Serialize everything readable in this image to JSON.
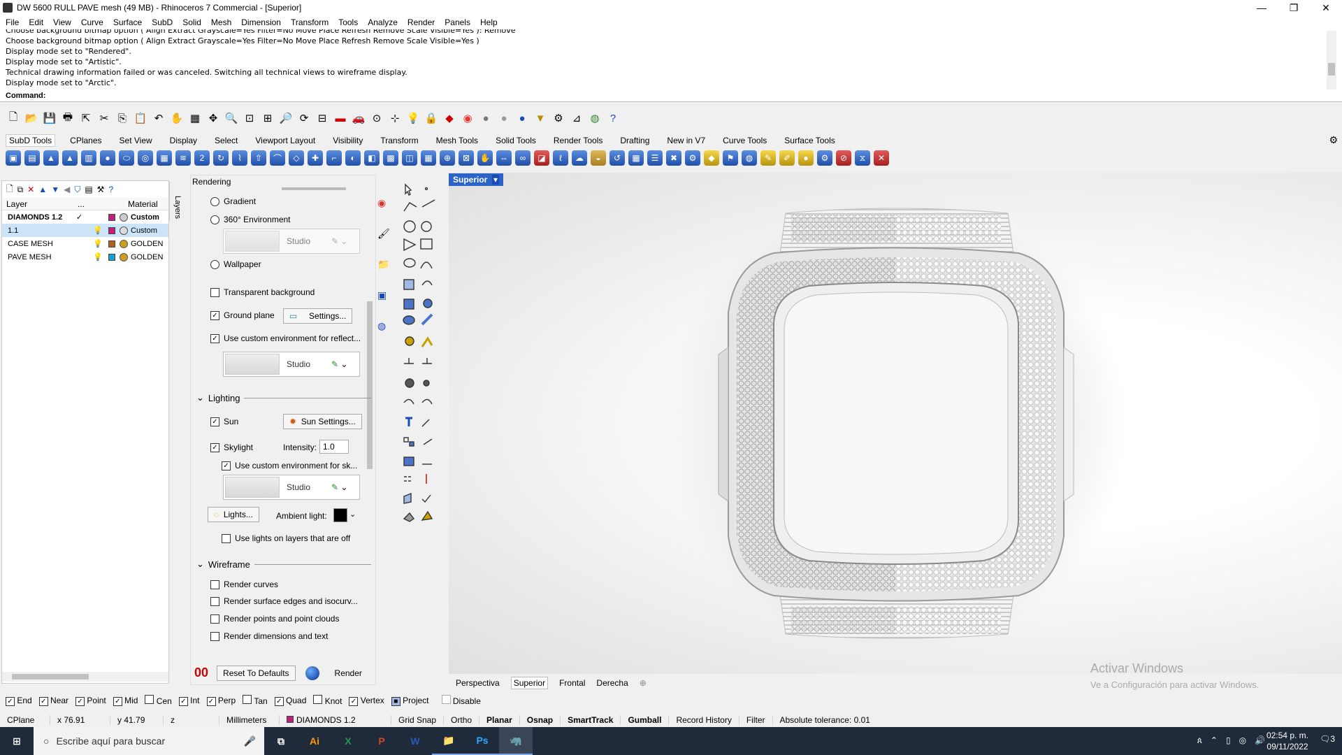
{
  "window": {
    "title": "DW 5600 RULL PAVE mesh (49 MB) - Rhinoceros 7 Commercial - [Superior]",
    "min": "—",
    "max": "❐",
    "close": "✕"
  },
  "menu": [
    "File",
    "Edit",
    "View",
    "Curve",
    "Surface",
    "SubD",
    "Solid",
    "Mesh",
    "Dimension",
    "Transform",
    "Tools",
    "Analyze",
    "Render",
    "Panels",
    "Help"
  ],
  "history": [
    "Choose background bitmap option ( Align  Extract  Grayscale=Yes  Filter=No  Move  Place  Refresh  Remove  Scale  Visible=Yes ): Remove",
    "Choose background bitmap option ( Align  Extract  Grayscale=Yes  Filter=No  Move  Place  Refresh  Remove  Scale  Visible=Yes )",
    "Display mode set to \"Rendered\".",
    "Display mode set to \"Artistic\".",
    "Technical drawing information failed or was canceled. Switching all technical views to wireframe display.",
    "Display mode set to \"Arctic\"."
  ],
  "command": {
    "label": "Command:"
  },
  "toolbar_tabs": [
    "SubD Tools",
    "CPlanes",
    "Set View",
    "Display",
    "Select",
    "Viewport Layout",
    "Visibility",
    "Transform",
    "Mesh Tools",
    "Solid Tools",
    "Render Tools",
    "Drafting",
    "New in V7",
    "Curve Tools",
    "Surface Tools"
  ],
  "layers": {
    "headers": {
      "layer": "Layer",
      "dots": "...",
      "material": "Material"
    },
    "rows": [
      {
        "name": "DIAMONDS 1.2",
        "current": "✓",
        "color": "#c0207a",
        "material": "Custom",
        "bold": true
      },
      {
        "name": "1.1",
        "current": "",
        "color": "#c0207a",
        "material": "Custom",
        "selected": true
      },
      {
        "name": "CASE MESH",
        "current": "",
        "color": "#b06020",
        "material": "GOLDEN"
      },
      {
        "name": "PAVE MESH",
        "current": "",
        "color": "#1aa0d0",
        "material": "GOLDEN"
      }
    ],
    "tab": "Layers"
  },
  "render": {
    "title": "Rendering",
    "gradient": "Gradient",
    "env360": "360° Environment",
    "studio": "Studio",
    "wallpaper": "Wallpaper",
    "transparent": "Transparent background",
    "ground": "Ground plane",
    "settings": "Settings...",
    "custom_env_reflect": "Use custom environment for reflect...",
    "lighting": "Lighting",
    "sun": "Sun",
    "sun_settings": "Sun Settings...",
    "skylight": "Skylight",
    "intensity_label": "Intensity:",
    "intensity": "1.0",
    "custom_env_sky": "Use custom environment for sk...",
    "lights": "Lights...",
    "ambient": "Ambient light:",
    "lights_on_off": "Use lights on layers that are off",
    "wireframe": "Wireframe",
    "render_curves": "Render curves",
    "render_edges": "Render surface edges and isocurv...",
    "render_points": "Render points and point clouds",
    "render_dims": "Render dimensions and text",
    "reset": "Reset To Defaults",
    "render_btn": "Render"
  },
  "viewport": {
    "label": "Superior",
    "tabs": [
      "Perspectiva",
      "Superior",
      "Frontal",
      "Derecha"
    ],
    "add": "⊕"
  },
  "activate": {
    "line1": "Activar Windows",
    "line2": "Ve a Configuración para activar Windows."
  },
  "osnaps": [
    {
      "label": "End",
      "checked": true
    },
    {
      "label": "Near",
      "checked": true
    },
    {
      "label": "Point",
      "checked": true
    },
    {
      "label": "Mid",
      "checked": true
    },
    {
      "label": "Cen",
      "checked": false
    },
    {
      "label": "Int",
      "checked": true
    },
    {
      "label": "Perp",
      "checked": true
    },
    {
      "label": "Tan",
      "checked": false
    },
    {
      "label": "Quad",
      "checked": true
    },
    {
      "label": "Knot",
      "checked": false
    },
    {
      "label": "Vertex",
      "checked": true
    },
    {
      "label": "Project",
      "checked": true
    },
    {
      "label": "Disable",
      "checked": false
    }
  ],
  "status": {
    "cplane": "CPlane",
    "x": "x 76.91",
    "y": "y 41.79",
    "z": "z",
    "units": "Millimeters",
    "layer": "DIAMONDS 1.2",
    "grid": "Grid Snap",
    "ortho": "Ortho",
    "planar": "Planar",
    "osnap": "Osnap",
    "smarttrack": "SmartTrack",
    "gumball": "Gumball",
    "history": "Record History",
    "filter": "Filter",
    "tolerance": "Absolute tolerance: 0.01"
  },
  "taskbar": {
    "search": "Escribe aquí para buscar",
    "time": "02:54 p. m.",
    "date": "09/11/2022",
    "apps": [
      "Ai",
      "X",
      "P",
      "W",
      "📁",
      "Ps",
      "🦏"
    ],
    "notifications": "3"
  }
}
